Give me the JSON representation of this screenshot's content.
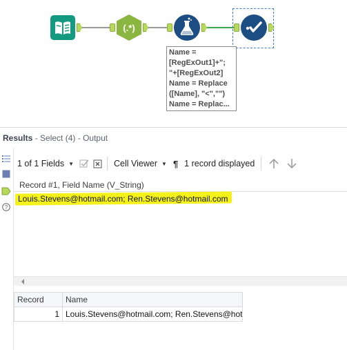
{
  "workflow": {
    "annotation_lines": [
      "Name =",
      "[RegExOut1]+\";",
      "\"+[RegExOut2]",
      "Name = Replace",
      "([Name], \"<\",\"\")",
      "Name = Replac..."
    ],
    "regex_tool_label": "(.*)",
    "colors": {
      "input": "#159a82",
      "regex": "#8ab541",
      "formula": "#1c4e84",
      "select": "#1c4e84",
      "anchor": "#b7d95b",
      "connection_active": "#3cab4e"
    }
  },
  "results": {
    "title": "Results",
    "separator1": " - ",
    "tool_name": "Select (4)",
    "separator2": " - ",
    "anchor_name": "Output"
  },
  "toolbar": {
    "fields_label": "1 of 1 Fields",
    "viewer_label": "Cell Viewer",
    "records_label": "1 record displayed"
  },
  "cell_view": {
    "header": "Record #1, Field Name (V_String)",
    "value": "Louis.Stevens@hotmail.com; Ren.Stevens@hotmail.com"
  },
  "grid": {
    "columns": [
      "Record",
      "Name"
    ],
    "rows": [
      [
        "1",
        "Louis.Stevens@hotmail.com; Ren.Stevens@hotm..."
      ]
    ]
  }
}
